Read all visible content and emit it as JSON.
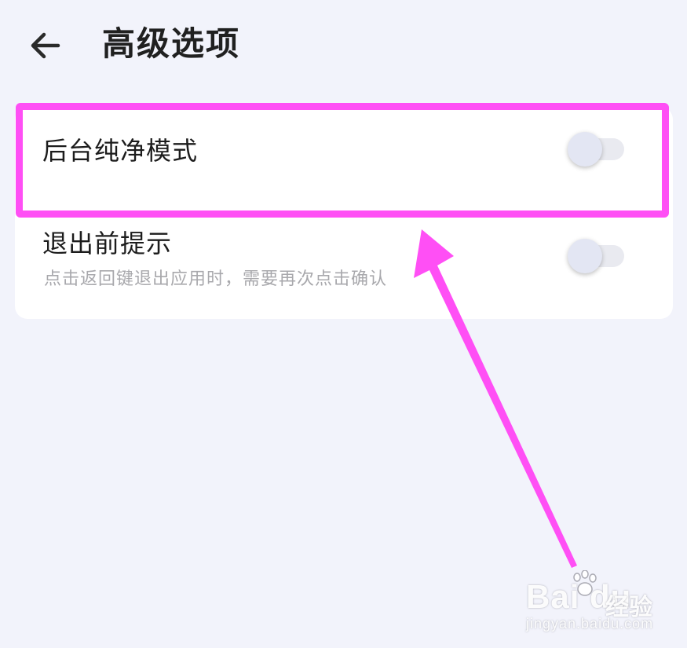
{
  "header": {
    "title": "高级选项",
    "back_icon": "arrow-left-icon"
  },
  "settings": [
    {
      "title": "后台纯净模式",
      "toggle_on": false
    },
    {
      "title": "退出前提示",
      "subtitle": "点击返回键退出应用时，需要再次点击确认",
      "toggle_on": false
    }
  ],
  "annotation": {
    "highlight_color": "#ff4ff5"
  },
  "watermark": {
    "brand": "Bai du",
    "product": "经验",
    "url": "jingyan.baidu.com"
  }
}
